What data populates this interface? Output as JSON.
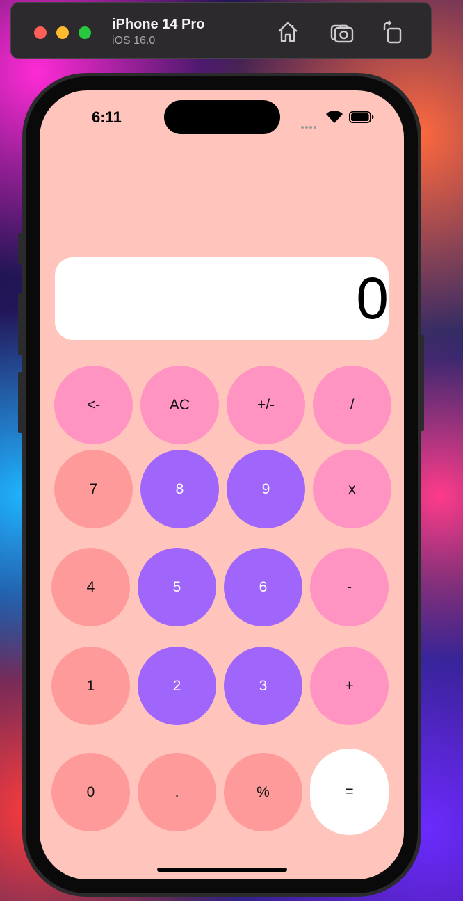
{
  "simulator": {
    "device_name": "iPhone 14 Pro",
    "os_version": "iOS 16.0",
    "icons": [
      "home-icon",
      "screenshot-icon",
      "rotate-icon"
    ]
  },
  "status_bar": {
    "time": "6:11",
    "icons": [
      "signal-icon",
      "wifi-icon",
      "battery-icon"
    ]
  },
  "display": {
    "value": "0"
  },
  "keys": {
    "backspace": "<-",
    "clear": "AC",
    "sign": "+/-",
    "divide": "/",
    "seven": "7",
    "eight": "8",
    "nine": "9",
    "multiply": "x",
    "four": "4",
    "five": "5",
    "six": "6",
    "minus": "-",
    "one": "1",
    "two": "2",
    "three": "3",
    "plus": "+",
    "zero": "0",
    "decimal": ".",
    "percent": "%",
    "equals": "="
  },
  "colors": {
    "screen_bg": "#ffc5bc",
    "function_key": "#ff94c2",
    "digit_key_light": "#ff9a9a",
    "digit_key_purple": "#a066fc",
    "equals_key": "#ffffff",
    "display_bg": "#ffffff"
  }
}
